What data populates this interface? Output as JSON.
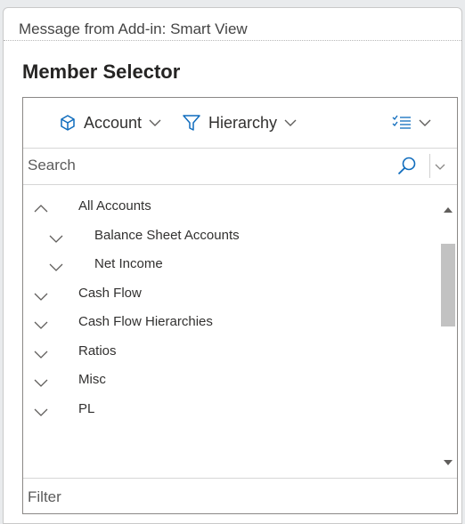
{
  "dialog": {
    "title": "Message from Add-in: Smart View",
    "heading": "Member Selector"
  },
  "toolbar": {
    "dimension_label": "Account",
    "dimension_icon": "cube-icon",
    "filter_label": "Hierarchy",
    "filter_icon": "filter-icon",
    "options_icon": "checklist-icon"
  },
  "search": {
    "placeholder": "Search",
    "value": ""
  },
  "tree": {
    "items": [
      {
        "label": "All Accounts",
        "expanded": true,
        "level": 0
      },
      {
        "label": "Balance Sheet Accounts",
        "expanded": false,
        "level": 1
      },
      {
        "label": "Net Income",
        "expanded": false,
        "level": 1
      },
      {
        "label": "Cash Flow",
        "expanded": false,
        "level": 0
      },
      {
        "label": "Cash Flow Hierarchies",
        "expanded": false,
        "level": 0
      },
      {
        "label": "Ratios",
        "expanded": false,
        "level": 0
      },
      {
        "label": "Misc",
        "expanded": false,
        "level": 0
      },
      {
        "label": "PL",
        "expanded": false,
        "level": 0
      }
    ]
  },
  "filter": {
    "placeholder": "Filter",
    "value": ""
  },
  "colors": {
    "accent": "#0f6cbd",
    "border": "#8a8886",
    "scroll_thumb": "#c2c2c2"
  }
}
